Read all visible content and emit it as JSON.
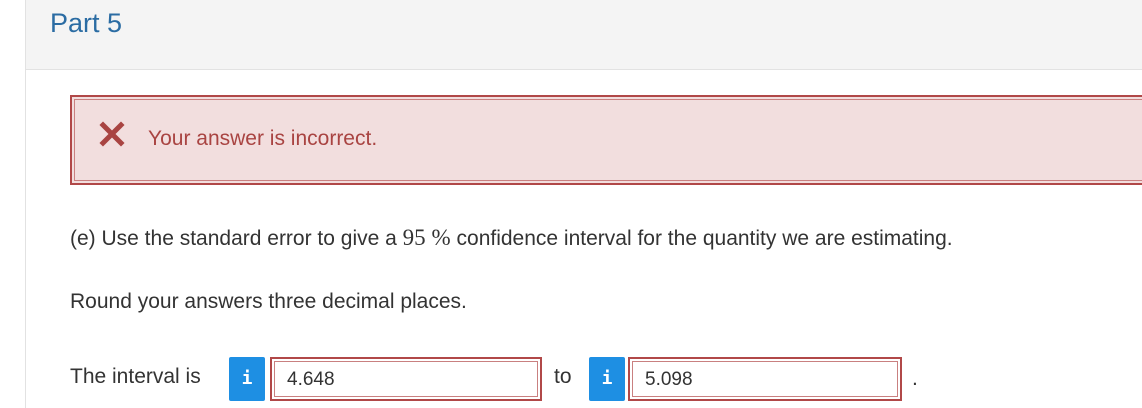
{
  "part": {
    "title": "Part 5"
  },
  "feedback": {
    "icon": "close-icon",
    "message": "Your answer is incorrect.",
    "color": "#a94442",
    "background": "#f2dede"
  },
  "question": {
    "prefix": "(e) Use the standard error to give a ",
    "confidence_value": "95",
    "percent_symbol": "%",
    "suffix": " confidence interval for the quantity we are estimating."
  },
  "instruction": "Round your answers three decimal places.",
  "interval": {
    "label": "The interval is",
    "info_icon_glyph": "i",
    "lower_value": "4.648",
    "to_label": "to",
    "upper_value": "5.098",
    "end_punctuation": "."
  },
  "colors": {
    "accent_blue": "#2b6ca3",
    "info_button": "#1e8fe3",
    "error_border": "#b14848"
  }
}
